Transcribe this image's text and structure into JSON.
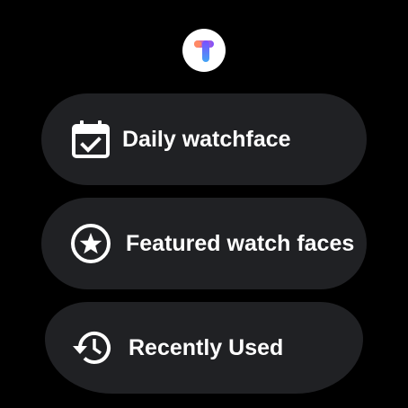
{
  "app": {
    "logo_icon": "tiles-t-logo-icon"
  },
  "menu": {
    "items": [
      {
        "label": "Daily watchface",
        "icon": "calendar-check-icon"
      },
      {
        "label": "Featured watch faces",
        "icon": "star-circle-icon"
      },
      {
        "label": "Recently Used",
        "icon": "history-icon"
      }
    ]
  },
  "colors": {
    "background": "#000000",
    "card": "#202124",
    "text": "#ffffff",
    "logo_pink": "#f06292",
    "logo_purple": "#7c4dff",
    "logo_blue": "#42a5f5",
    "logo_orange": "#ff8a65"
  }
}
